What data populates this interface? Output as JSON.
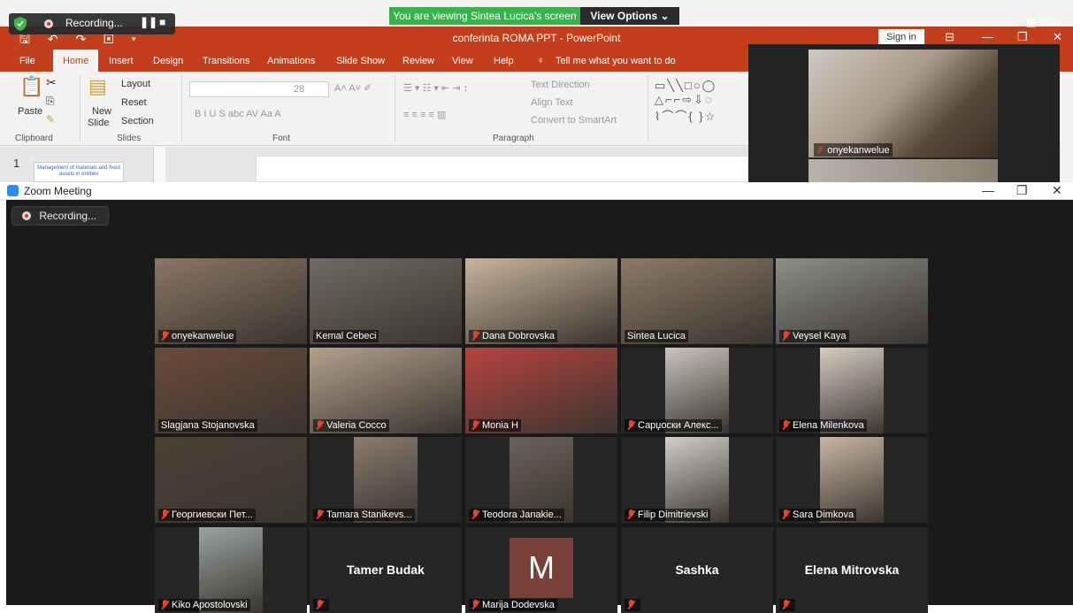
{
  "powerpoint": {
    "document_title": "conferinta ROMA PPT  -  PowerPoint",
    "sign_in": "Sign in",
    "tabs": [
      "File",
      "Home",
      "Insert",
      "Design",
      "Transitions",
      "Animations",
      "Slide Show",
      "Review",
      "View",
      "Help",
      "Tell me what you want to do"
    ],
    "ribbon": {
      "paste": "Paste",
      "new_slide": "New",
      "new_slide_2": "Slide",
      "layout": "Layout",
      "reset": "Reset",
      "section": "Section",
      "font_size": "28",
      "text_direction": "Text Direction",
      "align_text": "Align Text",
      "convert_smartart": "Convert to SmartArt",
      "font_format_row": "B  I  U  S  abc  AV  Aa  A",
      "groups": {
        "clipboard": "Clipboard",
        "slides": "Slides",
        "font": "Font",
        "paragraph": "Paragraph"
      }
    },
    "slide_thumb_number": "1",
    "slide_thumb_text": "Management of materials and fixed assets in entities"
  },
  "share_bar": {
    "recording": "Recording...",
    "viewing": "You are viewing Sintea Lucica's screen",
    "view_options": "View Options",
    "view": "View"
  },
  "floating_video": {
    "name": "onyekanwelue"
  },
  "zoom": {
    "window_title": "Zoom Meeting",
    "recording": "Recording...",
    "participants": [
      {
        "name": "onyekanwelue",
        "muted": true,
        "type": "video",
        "color": "#8a7664"
      },
      {
        "name": "Kemal Cebeci",
        "muted": false,
        "type": "video",
        "color": "#6f6a62",
        "active": true
      },
      {
        "name": "Dana Dobrovska",
        "muted": true,
        "type": "video",
        "color": "#c7b49a"
      },
      {
        "name": "Sintea Lucica",
        "muted": false,
        "type": "video",
        "color": "#8c7a66"
      },
      {
        "name": "Veysel Kaya",
        "muted": true,
        "type": "video",
        "color": "#8d8d8a"
      },
      {
        "name": "Slagjana Stojanovska",
        "muted": false,
        "type": "video",
        "color": "#6b4b3a"
      },
      {
        "name": "Valeria Cocco",
        "muted": true,
        "type": "video",
        "color": "#b3a08c"
      },
      {
        "name": "Monia H",
        "muted": true,
        "type": "video",
        "color": "#b8433e"
      },
      {
        "name": "Сарџоски Алекс...",
        "muted": true,
        "type": "video",
        "color": "#c9c4bc",
        "narrow": true
      },
      {
        "name": "Elena Milenkova",
        "muted": true,
        "type": "video",
        "color": "#d5cdc1",
        "narrow": true
      },
      {
        "name": "Георгиевски Пет...",
        "muted": true,
        "type": "video",
        "color": "#4a4236"
      },
      {
        "name": "Tamara Stanikevs...",
        "muted": true,
        "type": "video",
        "color": "#8a7c70",
        "narrow": true
      },
      {
        "name": "Teodora Janakie...",
        "muted": true,
        "type": "video",
        "color": "#6b625a",
        "narrow": true
      },
      {
        "name": "Filip Dimitrievski",
        "muted": true,
        "type": "video",
        "color": "#d1cdc7",
        "narrow": true
      },
      {
        "name": "Sara Dimkova",
        "muted": true,
        "type": "video",
        "color": "#c9b6a4",
        "narrow": true
      },
      {
        "name": "Kiko Apostolovski",
        "muted": true,
        "type": "video",
        "color": "#9aa3a0",
        "narrow": true
      },
      {
        "name": "",
        "muted": true,
        "type": "name",
        "display": "Tamer Budak"
      },
      {
        "name": "Marija Dodevska",
        "muted": true,
        "type": "avatar",
        "initial": "M"
      },
      {
        "name": "",
        "muted": true,
        "type": "name",
        "display": "Sashka"
      },
      {
        "name": "",
        "muted": true,
        "type": "name",
        "display": "Elena Mitrovska"
      }
    ]
  }
}
